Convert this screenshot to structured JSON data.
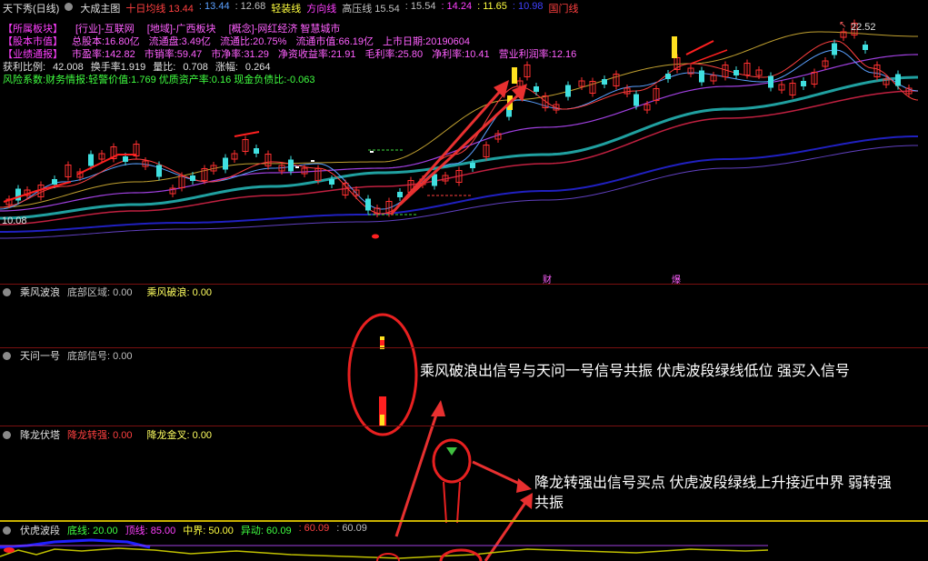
{
  "header": {
    "title": "天下秀(日线)",
    "main_chart": "大成主图",
    "ma": [
      {
        "label": "十日均线",
        "value": "13.44",
        "color": "#ff4040"
      },
      {
        "label": "",
        "value": "13.44",
        "color": "#5aa0ff"
      },
      {
        "label": "",
        "value": "12.68",
        "color": "#c0c0c0"
      },
      {
        "label": "轻装线",
        "value": "",
        "color": "#ffff40"
      },
      {
        "label": "方向线",
        "value": "",
        "color": "#ff40ff"
      },
      {
        "label": "高压线",
        "value": "15.54",
        "color": "#c0c0c0"
      },
      {
        "label": "",
        "value": "15.54",
        "color": "#c0c0c0"
      },
      {
        "label": "",
        "value": "14.24",
        "color": "#ff40ff"
      },
      {
        "label": "",
        "value": "11.65",
        "color": "#ffff40"
      },
      {
        "label": "",
        "value": "10.98",
        "color": "#4040ff"
      },
      {
        "label": "国门线",
        "value": "",
        "color": "#ff4040"
      }
    ]
  },
  "info": {
    "row1": [
      "【所属板块】",
      "[行业]-互联网",
      "[地域]-广西板块",
      "[概念]-网红经济 智慧城市"
    ],
    "row2": [
      "【股本市值】",
      "总股本:16.80亿",
      "流通盘:3.49亿",
      "流通比:20.75%",
      "流通市值:66.19亿",
      "上市日期:20190604"
    ],
    "row3": [
      "【业绩通报】",
      "市盈率:142.82",
      "市销率:59.47",
      "市净率:31.29",
      "净资收益率:21.91",
      "毛利率:25.80",
      "净利率:10.41",
      "营业利润率:12.16"
    ],
    "row4": [
      "获利比例:",
      "42.008",
      "换手率1.919",
      "量比:",
      "0.708",
      "涨幅:",
      "0.264"
    ],
    "row5": "风险系数:财务情报:轻警价值:1.769 优质资产率:0.16 现金负债比:-0.063"
  },
  "price_labels": {
    "high": "22.52",
    "low": "10.08"
  },
  "event_marks": [
    "财",
    "爆"
  ],
  "indicators": [
    {
      "name": "乘风波浪",
      "fields": [
        {
          "label": "底部区域:",
          "value": "0.00",
          "color": "#c0c0c0"
        },
        {
          "label": "乘风破浪:",
          "value": "0.00",
          "color": "#ffff60"
        }
      ]
    },
    {
      "name": "天问一号",
      "fields": [
        {
          "label": "底部信号:",
          "value": "0.00",
          "color": "#c0c0c0"
        }
      ]
    },
    {
      "name": "降龙伏塔",
      "fields": [
        {
          "label": "降龙转强:",
          "value": "0.00",
          "color": "#ff4040"
        },
        {
          "label": "降龙金叉:",
          "value": "0.00",
          "color": "#ffff60"
        }
      ]
    },
    {
      "name": "伏虎波段",
      "fields": [
        {
          "label": "底线:",
          "value": "20.00",
          "color": "#40ff40"
        },
        {
          "label": "顶线:",
          "value": "85.00",
          "color": "#ff40ff"
        },
        {
          "label": "中界:",
          "value": "50.00",
          "color": "#ffff40"
        },
        {
          "label": "异动:",
          "value": "60.09",
          "color": "#40ff40"
        },
        {
          "label": "",
          "value": "60.09",
          "color": "#ff4040"
        },
        {
          "label": "",
          "value": "60.09",
          "color": "#c0c0c0"
        }
      ]
    }
  ],
  "annotations": [
    "乘风破浪出信号与天问一号信号共振 伏虎波段绿线低位 强买入信号",
    "降龙转强出信号买点 伏虎波段绿线上升接近中界 弱转强",
    "共振"
  ],
  "colors": {
    "up": "#ff3030",
    "down": "#40e0e0",
    "arrow": "#e83030"
  }
}
